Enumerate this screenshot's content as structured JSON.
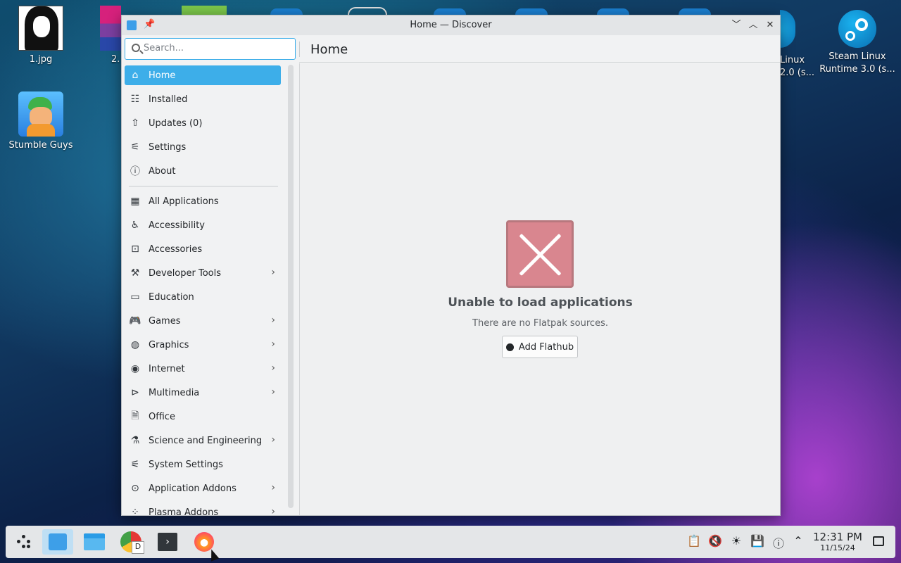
{
  "desktop": {
    "icons": [
      {
        "label": "1.jpg"
      },
      {
        "label": "2."
      },
      {
        "label": "Stumble Guys"
      },
      {
        "label_line1": "Linux",
        "label_line2": "2.0 (s..."
      },
      {
        "label_line1": "Steam Linux",
        "label_line2": "Runtime 3.0 (s..."
      }
    ]
  },
  "window": {
    "title": "Home — Discover",
    "controls": {
      "minimize": "﹀",
      "maximize": "︿",
      "close": "✕"
    }
  },
  "search": {
    "placeholder": "Search..."
  },
  "header": {
    "title": "Home"
  },
  "sidebar": {
    "top_items": [
      {
        "label": "Home",
        "icon": "home-icon"
      },
      {
        "label": "Installed",
        "icon": "installed-icon"
      },
      {
        "label": "Updates (0)",
        "icon": "updates-icon"
      },
      {
        "label": "Settings",
        "icon": "settings-icon"
      },
      {
        "label": "About",
        "icon": "info-icon"
      }
    ],
    "categories": [
      {
        "label": "All Applications",
        "icon": "grid-icon"
      },
      {
        "label": "Accessibility",
        "icon": "accessibility-icon"
      },
      {
        "label": "Accessories",
        "icon": "toolbox-icon"
      },
      {
        "label": "Developer Tools",
        "icon": "hammer-icon"
      },
      {
        "label": "Education",
        "icon": "education-icon"
      },
      {
        "label": "Games",
        "icon": "gamepad-icon"
      },
      {
        "label": "Graphics",
        "icon": "graphics-icon"
      },
      {
        "label": "Internet",
        "icon": "globe-icon"
      },
      {
        "label": "Multimedia",
        "icon": "multimedia-icon"
      },
      {
        "label": "Office",
        "icon": "office-icon"
      },
      {
        "label": "Science and Engineering",
        "icon": "flask-icon"
      },
      {
        "label": "System Settings",
        "icon": "sliders-icon"
      },
      {
        "label": "Application Addons",
        "icon": "addons-icon"
      },
      {
        "label": "Plasma Addons",
        "icon": "plasma-icon"
      }
    ]
  },
  "content": {
    "error_title": "Unable to load applications",
    "error_message": "There are no Flatpak sources.",
    "add_button": "Add Flathub"
  },
  "taskbar": {
    "clock_time": "12:31 PM",
    "clock_date": "11/15/24"
  }
}
